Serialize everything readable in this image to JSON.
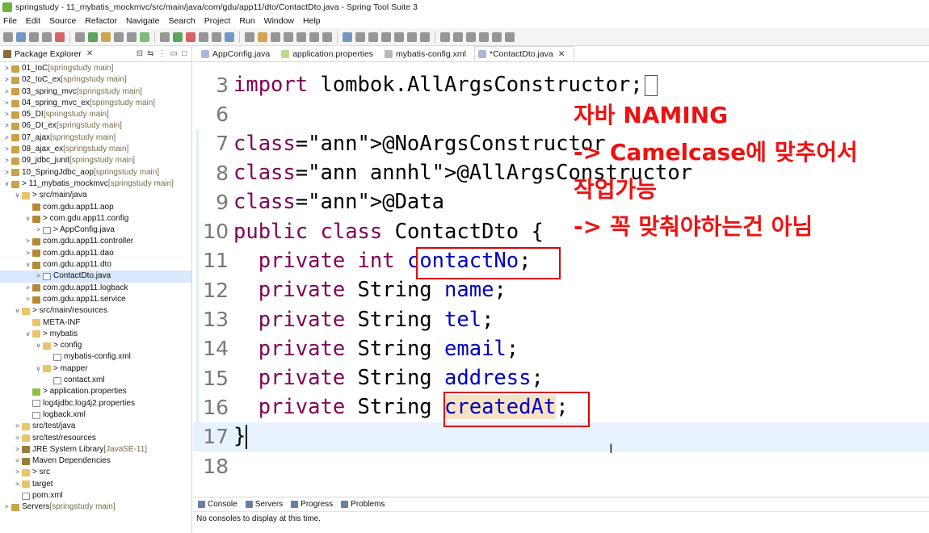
{
  "window": {
    "title": "springstudy - 11_mybatis_mockmvc/src/main/java/com/gdu/app11/dto/ContactDto.java - Spring Tool Suite 3"
  },
  "menu": [
    "File",
    "Edit",
    "Source",
    "Refactor",
    "Navigate",
    "Search",
    "Project",
    "Run",
    "Window",
    "Help"
  ],
  "package_explorer": {
    "title": "Package Explorer",
    "items": [
      {
        "indent": 0,
        "twisty": ">",
        "icon": "proj",
        "label": "01_IoC",
        "deco": " [springstudy main]"
      },
      {
        "indent": 0,
        "twisty": ">",
        "icon": "proj",
        "label": "02_IoC_ex",
        "deco": " [springstudy main]"
      },
      {
        "indent": 0,
        "twisty": ">",
        "icon": "proj",
        "label": "03_spring_mvc",
        "deco": " [springstudy main]"
      },
      {
        "indent": 0,
        "twisty": ">",
        "icon": "proj",
        "label": "04_spring_mvc_ex",
        "deco": " [springstudy main]"
      },
      {
        "indent": 0,
        "twisty": ">",
        "icon": "proj",
        "label": "05_DI",
        "deco": " [springstudy main]"
      },
      {
        "indent": 0,
        "twisty": ">",
        "icon": "proj",
        "label": "06_DI_ex",
        "deco": " [springstudy main]"
      },
      {
        "indent": 0,
        "twisty": ">",
        "icon": "proj",
        "label": "07_ajax",
        "deco": " [springstudy main]"
      },
      {
        "indent": 0,
        "twisty": ">",
        "icon": "proj",
        "label": "08_ajax_ex",
        "deco": " [springstudy main]"
      },
      {
        "indent": 0,
        "twisty": ">",
        "icon": "proj",
        "label": "09_jdbc_junit",
        "deco": " [springstudy main]"
      },
      {
        "indent": 0,
        "twisty": ">",
        "icon": "proj",
        "label": "10_SpringJdbc_aop",
        "deco": " [springstudy main]"
      },
      {
        "indent": 0,
        "twisty": "v",
        "icon": "proj",
        "label": "> 11_mybatis_mockmvc",
        "deco": " [springstudy main]"
      },
      {
        "indent": 1,
        "twisty": "v",
        "icon": "folder",
        "label": "> src/main/java",
        "deco": ""
      },
      {
        "indent": 2,
        "twisty": "",
        "icon": "pkg",
        "label": "com.gdu.app11.aop",
        "deco": ""
      },
      {
        "indent": 2,
        "twisty": "v",
        "icon": "pkg",
        "label": "> com.gdu.app11.config",
        "deco": ""
      },
      {
        "indent": 3,
        "twisty": ">",
        "icon": "java",
        "label": "> AppConfig.java",
        "deco": ""
      },
      {
        "indent": 2,
        "twisty": ">",
        "icon": "pkg",
        "label": "com.gdu.app11.controller",
        "deco": ""
      },
      {
        "indent": 2,
        "twisty": ">",
        "icon": "pkg",
        "label": "com.gdu.app11.dao",
        "deco": ""
      },
      {
        "indent": 2,
        "twisty": "v",
        "icon": "pkg",
        "label": "com.gdu.app11.dto",
        "deco": ""
      },
      {
        "indent": 3,
        "twisty": ">",
        "icon": "java",
        "label": "ContactDto.java",
        "deco": "",
        "selected": true
      },
      {
        "indent": 2,
        "twisty": ">",
        "icon": "pkg",
        "label": "com.gdu.app11.logback",
        "deco": ""
      },
      {
        "indent": 2,
        "twisty": ">",
        "icon": "pkg",
        "label": "com.gdu.app11.service",
        "deco": ""
      },
      {
        "indent": 1,
        "twisty": "v",
        "icon": "folder",
        "label": "> src/main/resources",
        "deco": ""
      },
      {
        "indent": 2,
        "twisty": "",
        "icon": "folder",
        "label": "META-INF",
        "deco": ""
      },
      {
        "indent": 2,
        "twisty": "v",
        "icon": "folder",
        "label": "> mybatis",
        "deco": ""
      },
      {
        "indent": 3,
        "twisty": "v",
        "icon": "folder",
        "label": "> config",
        "deco": ""
      },
      {
        "indent": 4,
        "twisty": "",
        "icon": "xml",
        "label": "mybatis-config.xml",
        "deco": ""
      },
      {
        "indent": 3,
        "twisty": "v",
        "icon": "folder",
        "label": "> mapper",
        "deco": ""
      },
      {
        "indent": 4,
        "twisty": "",
        "icon": "xml",
        "label": "contact.xml",
        "deco": ""
      },
      {
        "indent": 2,
        "twisty": "",
        "icon": "prop",
        "label": "> application.properties",
        "deco": ""
      },
      {
        "indent": 2,
        "twisty": "",
        "icon": "xml",
        "label": "log4jdbc.log4j2.properties",
        "deco": ""
      },
      {
        "indent": 2,
        "twisty": "",
        "icon": "xml",
        "label": "logback.xml",
        "deco": ""
      },
      {
        "indent": 1,
        "twisty": ">",
        "icon": "folder",
        "label": "src/test/java",
        "deco": ""
      },
      {
        "indent": 1,
        "twisty": ">",
        "icon": "folder",
        "label": "src/test/resources",
        "deco": ""
      },
      {
        "indent": 1,
        "twisty": ">",
        "icon": "lib",
        "label": "JRE System Library",
        "deco": " [JavaSE-11]"
      },
      {
        "indent": 1,
        "twisty": ">",
        "icon": "lib",
        "label": "Maven Dependencies",
        "deco": ""
      },
      {
        "indent": 1,
        "twisty": ">",
        "icon": "folder",
        "label": "> src",
        "deco": ""
      },
      {
        "indent": 1,
        "twisty": ">",
        "icon": "folder",
        "label": "target",
        "deco": ""
      },
      {
        "indent": 1,
        "twisty": "",
        "icon": "xml",
        "label": "pom.xml",
        "deco": ""
      },
      {
        "indent": 0,
        "twisty": ">",
        "icon": "proj",
        "label": "Servers",
        "deco": " [springstudy main]"
      }
    ]
  },
  "editor_tabs": [
    {
      "label": "AppConfig.java",
      "icon": "java",
      "active": false
    },
    {
      "label": "application.properties",
      "icon": "prop",
      "active": false
    },
    {
      "label": "mybatis-config.xml",
      "icon": "xml",
      "active": false
    },
    {
      "label": "*ContactDto.java",
      "icon": "java",
      "active": true
    }
  ],
  "code": {
    "lines": [
      {
        "num": "3",
        "text": "import lombok.AllArgsConstructor;"
      },
      {
        "num": "6",
        "text": ""
      },
      {
        "num": "7",
        "text": "@NoArgsConstructor"
      },
      {
        "num": "8",
        "text": "@AllArgsConstructor"
      },
      {
        "num": "9",
        "text": "@Data"
      },
      {
        "num": "10",
        "text": "public class ContactDto {"
      },
      {
        "num": "11",
        "text": "  private int contactNo;"
      },
      {
        "num": "12",
        "text": "  private String name;"
      },
      {
        "num": "13",
        "text": "  private String tel;"
      },
      {
        "num": "14",
        "text": "  private String email;"
      },
      {
        "num": "15",
        "text": "  private String address;"
      },
      {
        "num": "16",
        "text": "  private String createdAt;"
      },
      {
        "num": "17",
        "text": "}"
      },
      {
        "num": "18",
        "text": ""
      }
    ]
  },
  "annotation": {
    "lines": [
      "자바 NAMING",
      "-> Camelcase에 맞추어서",
      "작업가능",
      "-> 꼭 맞춰야하는건 아님"
    ],
    "color": "#ee1111"
  },
  "console": {
    "tabs": [
      "Console",
      "Servers",
      "Progress",
      "Problems"
    ],
    "message": "No consoles to display at this time."
  },
  "colors": {
    "keyword": "#7f0055",
    "field": "#0000c0",
    "annotation": "#646464",
    "highlight": "#f5e3c3",
    "current_line": "#e8f2fe"
  }
}
